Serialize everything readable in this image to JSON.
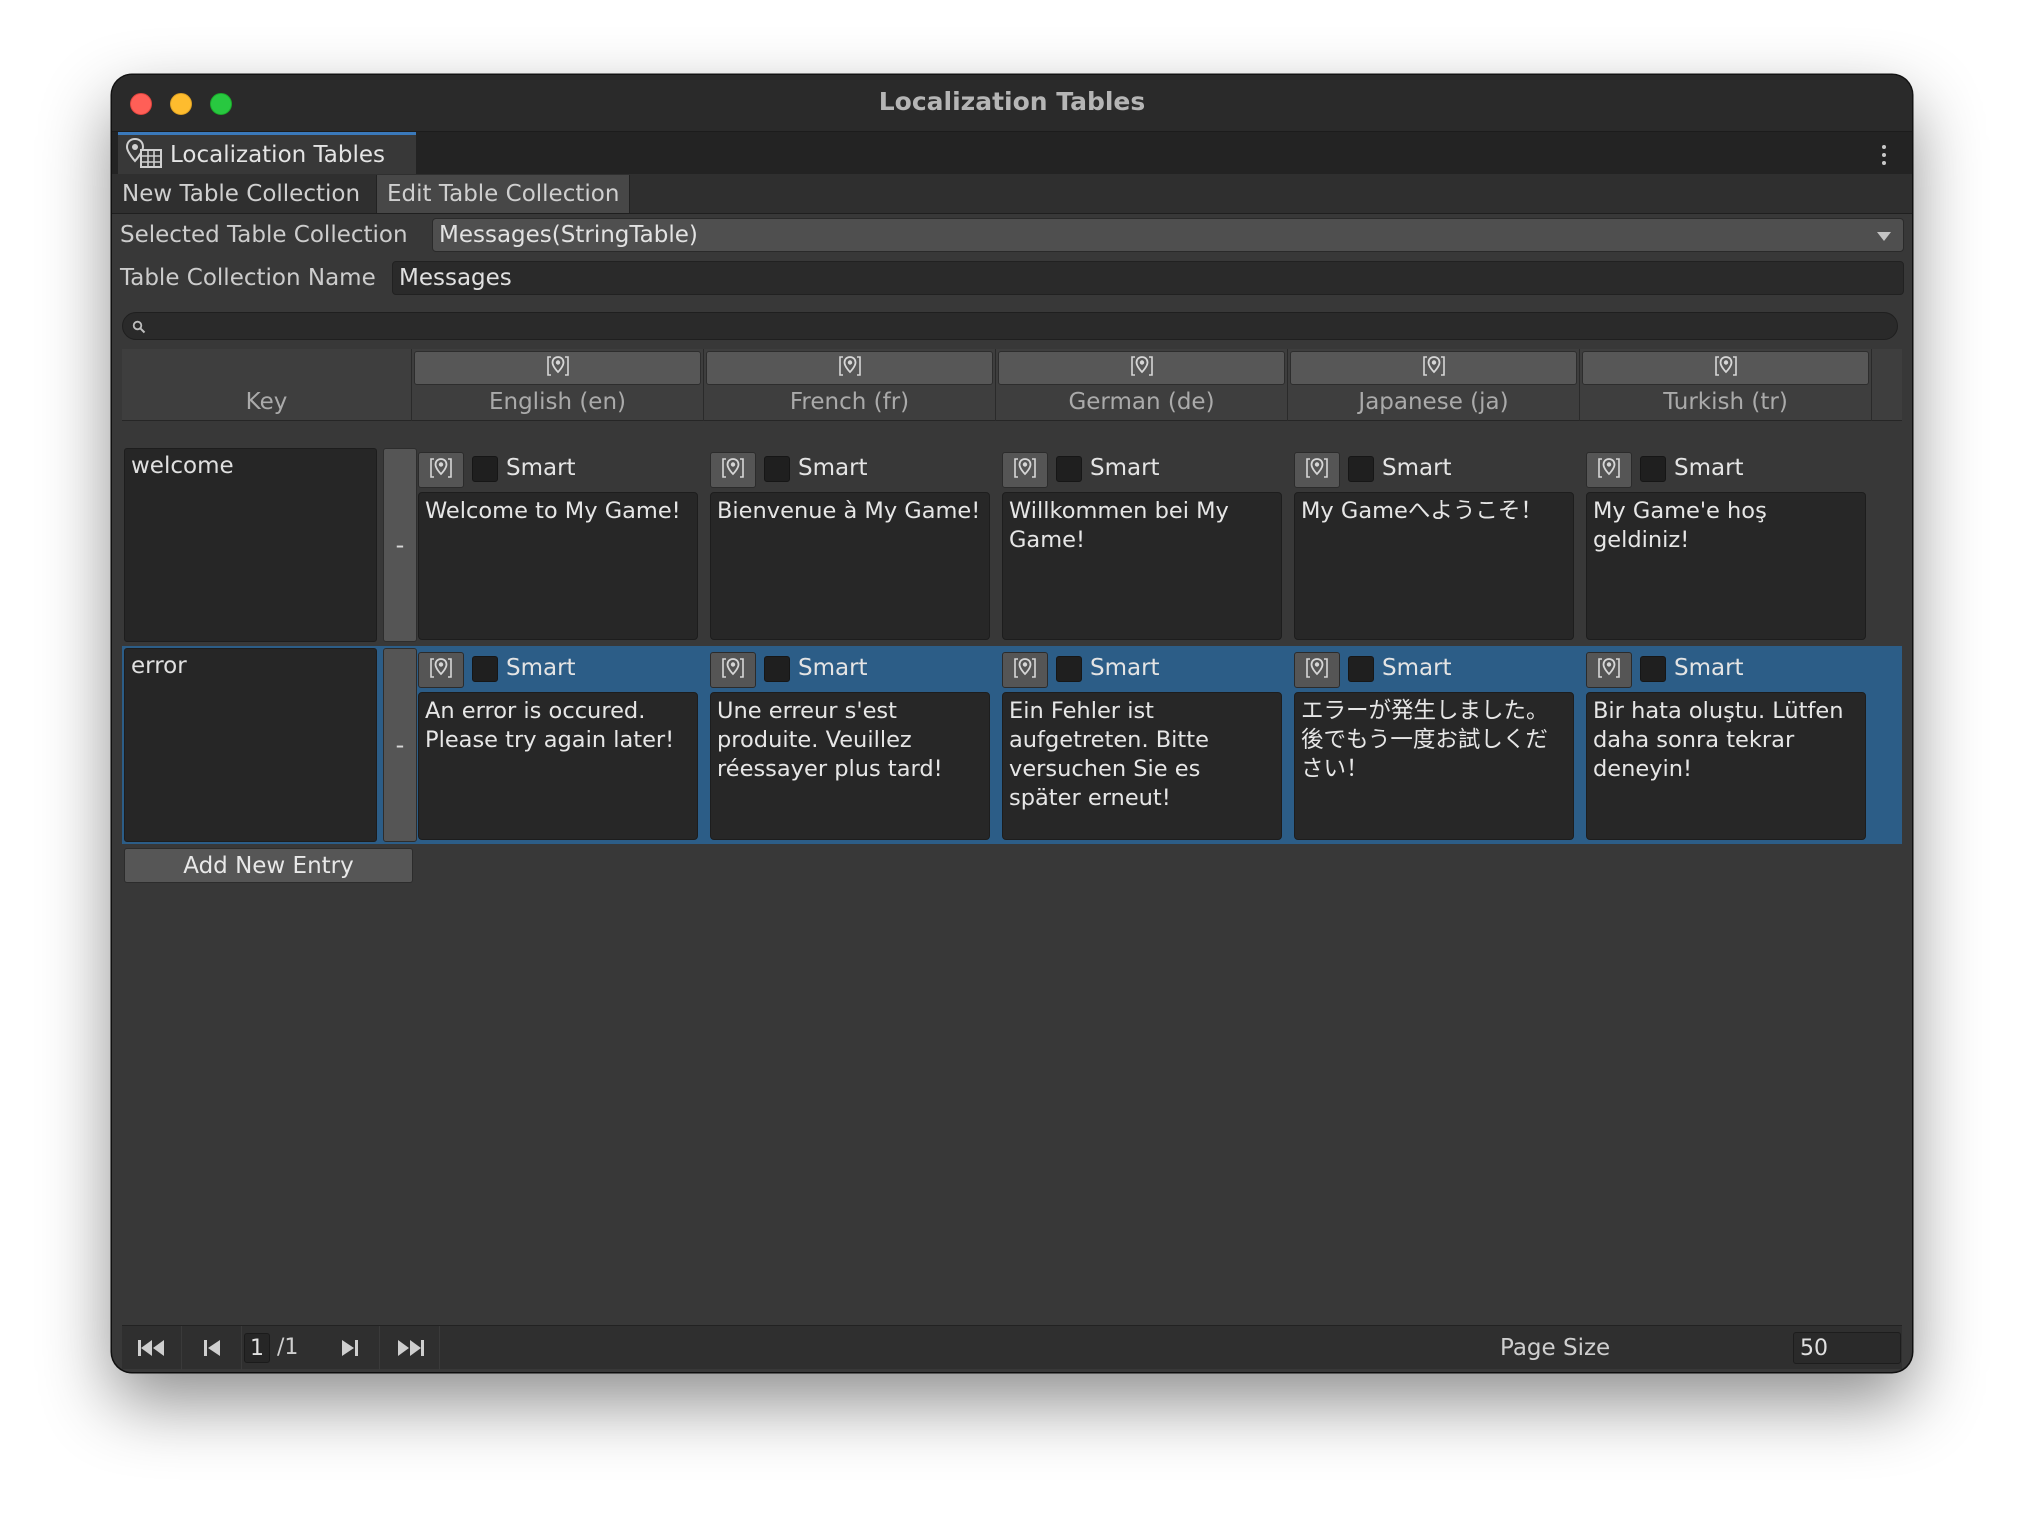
{
  "window": {
    "title": "Localization Tables",
    "tab_label": "Localization Tables",
    "tab_icon": "localization-table-icon"
  },
  "subtabs": [
    "New Table Collection",
    "Edit Table Collection"
  ],
  "selected_collection": {
    "label": "Selected Table Collection",
    "value": "Messages(StringTable)"
  },
  "collection_name": {
    "label": "Table Collection Name",
    "value": "Messages"
  },
  "search": {
    "placeholder": ""
  },
  "columns": {
    "key": "Key",
    "languages": [
      "English (en)",
      "French (fr)",
      "German (de)",
      "Japanese (ja)",
      "Turkish (tr)"
    ]
  },
  "smart_label": "Smart",
  "remove_label": "-",
  "entries": [
    {
      "key": "welcome",
      "values": [
        "Welcome to My Game!",
        "Bienvenue à My Game!",
        "Willkommen bei My Game!",
        "My Gameへようこそ！",
        "My Game'e hoş geldiniz!"
      ],
      "selected": false
    },
    {
      "key": "error",
      "values": [
        "An error is occured. Please try again later!",
        "Une erreur s'est produite. Veuillez réessayer plus tard!",
        "Ein Fehler ist aufgetreten. Bitte versuchen Sie es später erneut!",
        "エラーが発生しました。後でもう一度お試しください！",
        "Bir hata oluştu. Lütfen daha sonra tekrar deneyin!"
      ],
      "selected": true
    }
  ],
  "add_entry_label": "Add New Entry",
  "pagination": {
    "current_page": "1",
    "total_pages": "/1",
    "page_size_label": "Page Size",
    "page_size": "50"
  },
  "colors": {
    "selection": "#2c5d87",
    "accent": "#3a79bb",
    "background": "#383838"
  }
}
